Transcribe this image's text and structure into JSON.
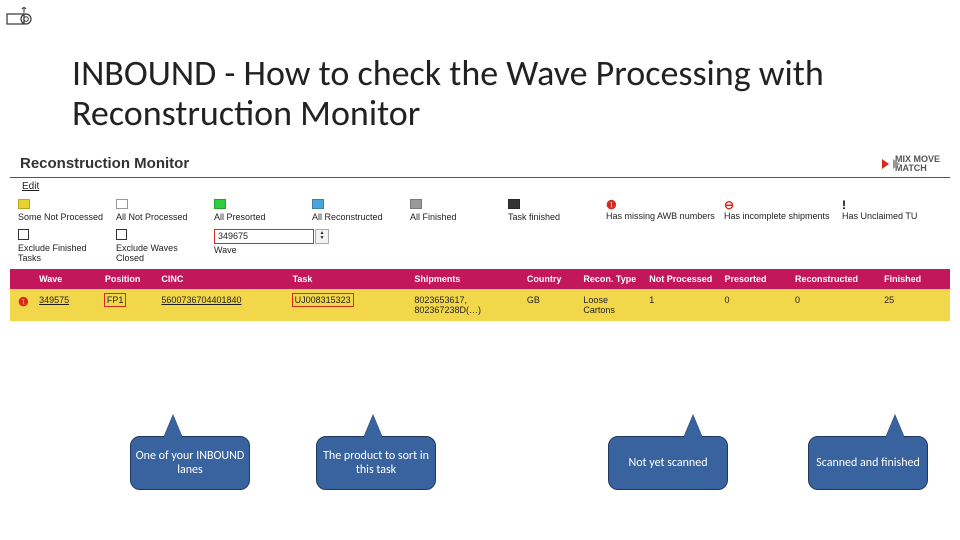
{
  "title": "INBOUND - How to check the Wave Processing with Reconstruction Monitor",
  "app": {
    "name": "Reconstruction Monitor",
    "menu": "Edit",
    "brand": "MIX MOVE MATCH"
  },
  "legend": {
    "l0": "Some Not Processed",
    "l1": "All Not Processed",
    "l2": "All Presorted",
    "l3": "All Reconstructed",
    "l4": "All Finished",
    "l5": "Task finished",
    "l6": "Has missing AWB numbers",
    "l7": "Has incomplete shipments",
    "l8": "Has Unclaimed TU"
  },
  "filters": {
    "f0": "Exclude Finished Tasks",
    "f1": "Exclude Waves Closed",
    "wave_value": "349675",
    "wave_label": "Wave"
  },
  "cols": {
    "wave": "Wave",
    "pos": "Position",
    "cinc": "CINC",
    "task": "Task",
    "ship": "Shipments",
    "ctry": "Country",
    "rec": "Recon. Type",
    "np": "Not Processed",
    "ps": "Presorted",
    "rc": "Reconstructed",
    "fin": "Finished"
  },
  "row": {
    "wave": "349575",
    "pos": "FP1",
    "cinc": "5600736704401840",
    "task": "UJ008315323",
    "ship": "8023653617, 802367238D(…)",
    "ctry": "GB",
    "rec": "Loose Cartons",
    "np": "1",
    "ps": "0",
    "rc": "0",
    "fin": "25"
  },
  "callouts": {
    "c1": "One of your INBOUND lanes",
    "c2": "The product to sort in this task",
    "c3": "Not yet scanned",
    "c4": "Scanned and finished"
  }
}
